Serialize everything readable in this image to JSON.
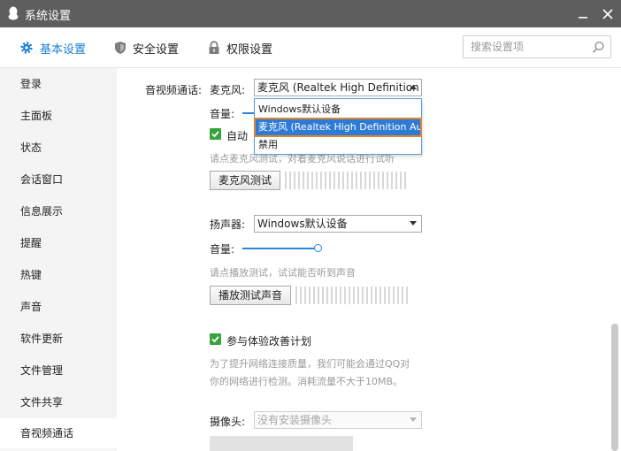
{
  "window": {
    "title": "系统设置"
  },
  "tabs": [
    {
      "label": "基本设置",
      "icon": "gear-icon",
      "active": true
    },
    {
      "label": "安全设置",
      "icon": "shield-icon",
      "active": false
    },
    {
      "label": "权限设置",
      "icon": "lock-icon",
      "active": false
    }
  ],
  "search": {
    "placeholder": "搜索设置项"
  },
  "sidebar": {
    "items": [
      {
        "label": "登录"
      },
      {
        "label": "主面板"
      },
      {
        "label": "状态"
      },
      {
        "label": "会话窗口"
      },
      {
        "label": "信息展示"
      },
      {
        "label": "提醒"
      },
      {
        "label": "热键"
      },
      {
        "label": "声音"
      },
      {
        "label": "软件更新"
      },
      {
        "label": "文件管理"
      },
      {
        "label": "文件共享"
      },
      {
        "label": "音视频通话"
      }
    ],
    "active_index": 11
  },
  "av": {
    "section_label": "音视频通话:",
    "mic": {
      "label": "麦克风:",
      "selected": "麦克风 (Realtek High Definition ...",
      "volume_label": "音量:",
      "auto_label": "自动",
      "hint": "请点麦克风测试，对着麦克风说话进行试听",
      "test_button": "麦克风测试",
      "dropdown_options": [
        "Windows默认设备",
        "麦克风 (Realtek High Definition Audio",
        "禁用"
      ],
      "dropdown_selected_index": 1
    },
    "speaker": {
      "label": "扬声器:",
      "selected": "Windows默认设备",
      "volume_label": "音量:",
      "volume_level": 0.85,
      "hint": "请点播放测试，试试能否听到声音",
      "test_button": "播放测试声音"
    },
    "improve": {
      "label": "参与体验改善计划",
      "checked": true,
      "desc_line1": "为了提升网络连接质量，我们可能会通过QQ对",
      "desc_line2": "你的网络进行检测。消耗流量不大于10MB。"
    },
    "camera": {
      "label": "摄像头:",
      "selected": "没有安装摄像头"
    }
  },
  "colors": {
    "titlebar": "#5e5e5e",
    "accent": "#1c7fd6",
    "check_green": "#37a33f",
    "highlight_orange": "#e0862f"
  }
}
